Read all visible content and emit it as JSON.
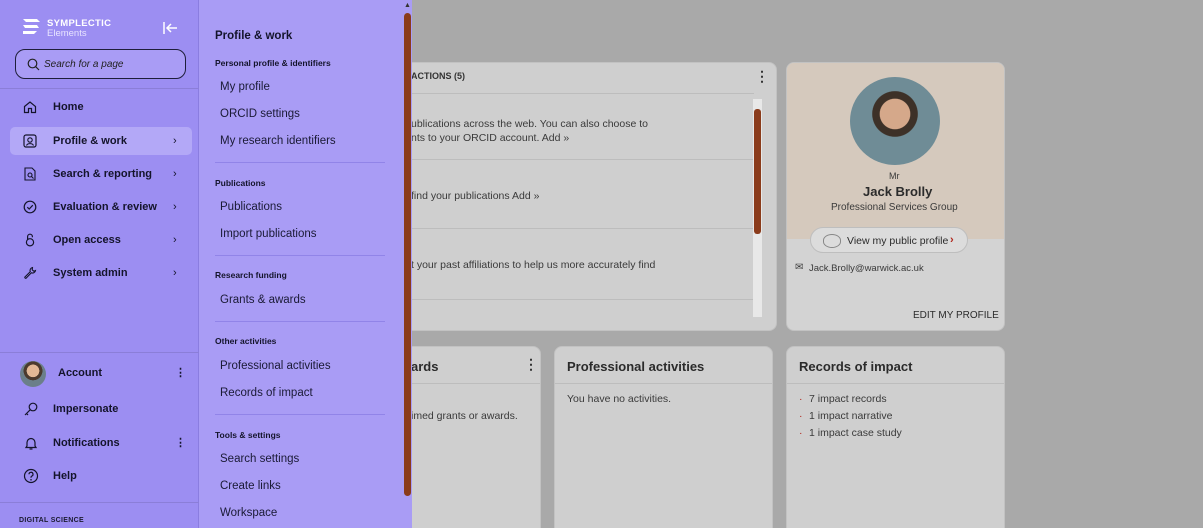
{
  "sidebar": {
    "logo_title": "SYMPLECTIC",
    "logo_subtitle": "Elements",
    "search_placeholder": "Search for a page",
    "nav": [
      {
        "label": "Home",
        "icon": "home-icon"
      },
      {
        "label": "Profile & work",
        "icon": "profile-icon",
        "active": true
      },
      {
        "label": "Search & reporting",
        "icon": "report-search-icon"
      },
      {
        "label": "Evaluation & review",
        "icon": "check-circle-icon"
      },
      {
        "label": "Open access",
        "icon": "open-access-icon"
      },
      {
        "label": "System admin",
        "icon": "wrench-icon"
      }
    ],
    "footer": [
      {
        "label": "Account",
        "icon": "avatar"
      },
      {
        "label": "Impersonate",
        "icon": "key-icon"
      },
      {
        "label": "Notifications",
        "icon": "bell-icon"
      },
      {
        "label": "Help",
        "icon": "help-icon"
      }
    ],
    "brand_footer": "DIGITAL SCIENCE"
  },
  "flyout": {
    "title": "Profile & work",
    "sections": [
      {
        "heading": "Personal profile & identifiers",
        "links": [
          "My profile",
          "ORCID settings",
          "My research identifiers"
        ]
      },
      {
        "heading": "Publications",
        "links": [
          "Publications",
          "Import publications"
        ]
      },
      {
        "heading": "Research funding",
        "links": [
          "Grants & awards"
        ]
      },
      {
        "heading": "Other activities",
        "links": [
          "Professional activities",
          "Records of impact"
        ]
      },
      {
        "heading": "Tools & settings",
        "links": [
          "Search settings",
          "Create links",
          "Workspace"
        ]
      }
    ]
  },
  "main": {
    "actions_card": {
      "title": "ACTIONS (5)",
      "items": [
        {
          "line1": "ublications across the web. You can also choose to",
          "line2": "nts to your ORCID account. Add »"
        },
        {
          "line1": "find your publications Add »"
        },
        {
          "line1": "t your past affiliations to help us more accurately find"
        }
      ]
    },
    "profile_card": {
      "honorific": "Mr",
      "name": "Jack Brolly",
      "group": "Professional Services Group",
      "public_profile_label": "View my public profile",
      "email": "Jack.Brolly@warwick.ac.uk",
      "edit_label": "EDIT MY PROFILE"
    },
    "awards_card": {
      "title": "ards",
      "text": "imed grants or awards."
    },
    "activities_card": {
      "title": "Professional activities",
      "text": "You have no activities."
    },
    "impact_card": {
      "title": "Records of impact",
      "items": [
        "7 impact records",
        "1 impact narrative",
        "1 impact case study"
      ]
    }
  },
  "colors": {
    "sidebar": "#9c8ef2",
    "flyout": "#a99cf5",
    "scroll_thumb": "#8a3b1b",
    "overlay": "#a9a9a9"
  }
}
